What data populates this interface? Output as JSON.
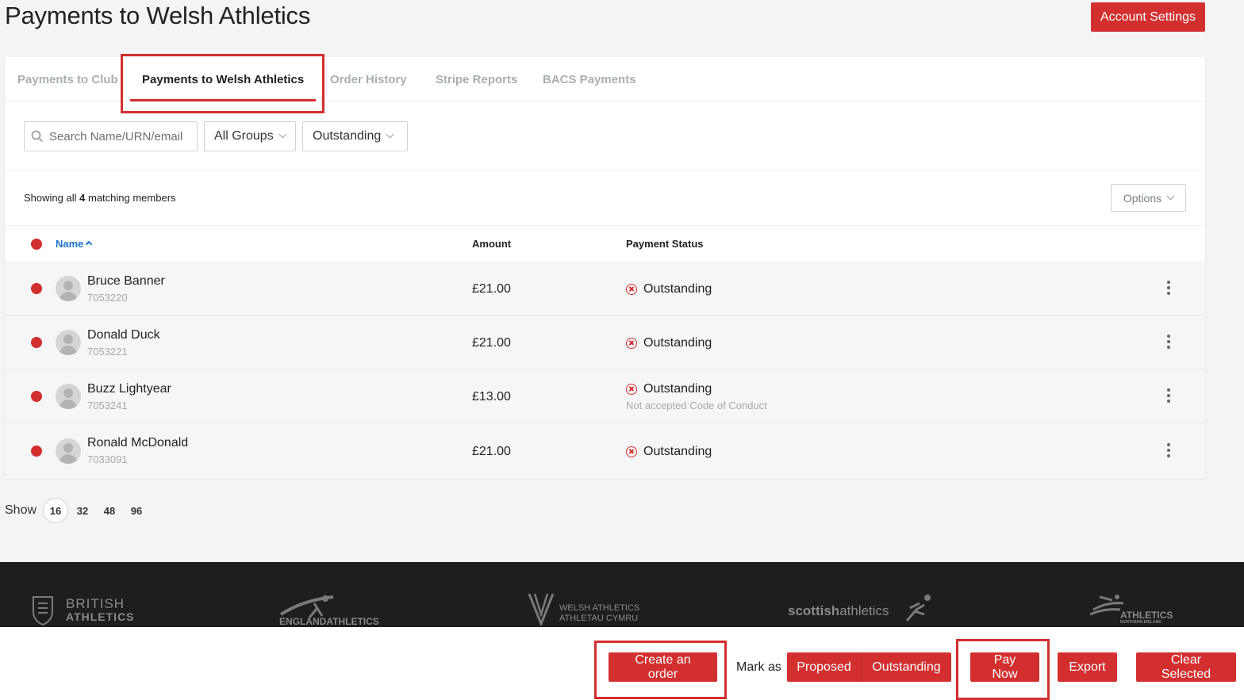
{
  "header": {
    "title": "Payments to Welsh Athletics",
    "account_settings_label": "Account Settings"
  },
  "tabs": [
    {
      "label": "Payments to Club",
      "active": false
    },
    {
      "label": "Payments to Welsh Athletics",
      "active": true
    },
    {
      "label": "Order History",
      "active": false
    },
    {
      "label": "Stripe Reports",
      "active": false
    },
    {
      "label": "BACS Payments",
      "active": false
    }
  ],
  "filters": {
    "search_placeholder": "Search Name/URN/email",
    "group_select": "All Groups",
    "status_select": "Outstanding"
  },
  "summary": {
    "prefix": "Showing all",
    "count": "4",
    "suffix": "matching members",
    "options_label": "Options"
  },
  "table": {
    "columns": {
      "name": "Name",
      "amount": "Amount",
      "status": "Payment Status"
    },
    "rows": [
      {
        "name": "Bruce Banner",
        "urn": "7053220",
        "amount": "£21.00",
        "status": "Outstanding",
        "note": ""
      },
      {
        "name": "Donald Duck",
        "urn": "7053221",
        "amount": "£21.00",
        "status": "Outstanding",
        "note": ""
      },
      {
        "name": "Buzz Lightyear",
        "urn": "7053241",
        "amount": "£13.00",
        "status": "Outstanding",
        "note": "Not accepted Code of Conduct"
      },
      {
        "name": "Ronald McDonald",
        "urn": "7033091",
        "amount": "£21.00",
        "status": "Outstanding",
        "note": ""
      }
    ]
  },
  "pager": {
    "label": "Show",
    "options": [
      "16",
      "32",
      "48",
      "96"
    ],
    "current": "16"
  },
  "footer_logos": {
    "british_1": "BRITISH",
    "british_2": "ATHLETICS",
    "england_1": "ENGLAND",
    "england_2": "ATHLETICS",
    "welsh_1": "WELSH ATHLETICS",
    "welsh_2": "ATHLETAU CYMRU",
    "scottish_1": "scottish",
    "scottish_2": "athletics",
    "ni_1": "ATHLETICS",
    "ni_2": "NORTHERN IRELAND"
  },
  "actions": {
    "create_order": "Create an order",
    "mark_as": "Mark as",
    "proposed": "Proposed",
    "outstanding": "Outstanding",
    "pay_now": "Pay Now",
    "export": "Export",
    "clear_selected": "Clear Selected"
  },
  "colors": {
    "accent": "#d32f2f",
    "link": "#1a73c8",
    "footer_bg": "#1e1e1e"
  }
}
